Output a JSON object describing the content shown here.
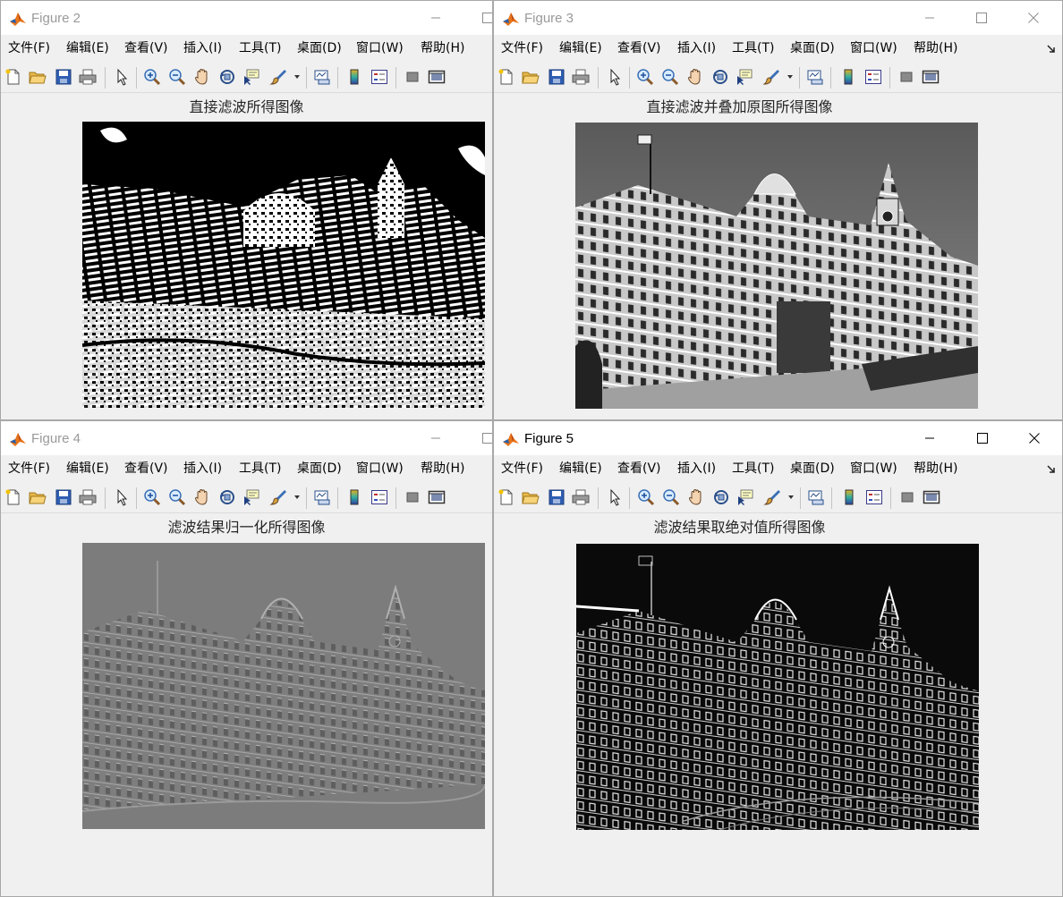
{
  "menu": [
    "文件(F)",
    "编辑(E)",
    "查看(V)",
    "插入(I)",
    "工具(T)",
    "桌面(D)",
    "窗口(W)",
    "帮助(H)"
  ],
  "figures": [
    {
      "title": "Figure 2",
      "axes_title": "直接滤波所得图像",
      "active": false
    },
    {
      "title": "Figure 3",
      "axes_title": "直接滤波并叠加原图所得图像",
      "active": false
    },
    {
      "title": "Figure 4",
      "axes_title": "滤波结果归一化所得图像",
      "active": false
    },
    {
      "title": "Figure 5",
      "axes_title": "滤波结果取绝对值所得图像",
      "active": true
    }
  ],
  "toolbar_icons": [
    "new-figure-icon",
    "open-file-icon",
    "save-icon",
    "print-icon",
    "edit-plot-arrow-icon",
    "zoom-in-icon",
    "zoom-out-icon",
    "pan-hand-icon",
    "rotate-3d-icon",
    "data-cursor-icon",
    "brush-icon",
    "link-plot-icon",
    "colorbar-icon",
    "legend-icon",
    "hide-plot-tools-icon",
    "show-plot-tools-icon"
  ],
  "colors": {
    "background": "#f0f0f0",
    "titlebar": "#ffffff",
    "matlab_orange": "#e8751a",
    "matlab_blue": "#2a5fa8"
  }
}
